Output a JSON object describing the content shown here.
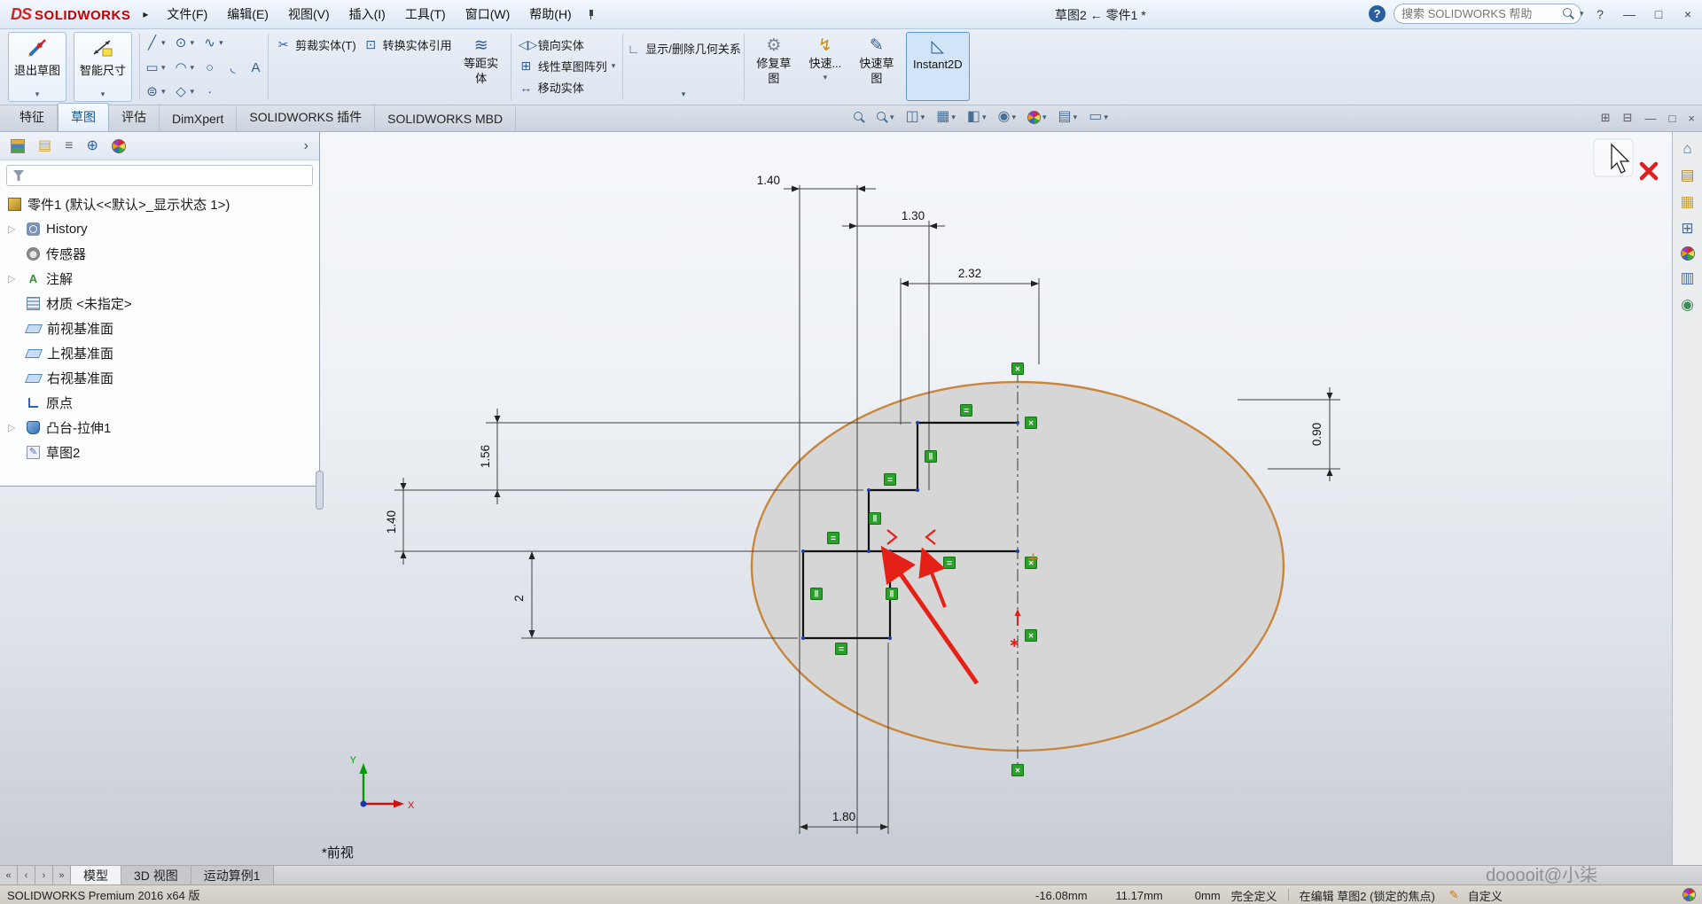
{
  "titlebar": {
    "logo_ds": "DS",
    "logo_text": "SOLIDWORKS",
    "menu_expand": "▸",
    "menus": [
      "文件(F)",
      "编辑(E)",
      "视图(V)",
      "插入(I)",
      "工具(T)",
      "窗口(W)",
      "帮助(H)"
    ],
    "doc_title": "草图2 ← 零件1 *",
    "help_badge": "?",
    "search_placeholder": "搜索 SOLIDWORKS 帮助",
    "help_menu": "?",
    "win_min": "—",
    "win_max": "□",
    "win_close": "×"
  },
  "ribbon": {
    "exit_sketch": "退出草图",
    "smart_dimension": "智能尺寸",
    "trim_entities": "剪裁实体(T)",
    "convert_entities": "转换实体引用",
    "offset_l1": "等距实",
    "offset_l2": "体",
    "mirror_entities": "镜向实体",
    "linear_pattern": "线性草图阵列",
    "move_entities": "移动实体",
    "display_relations": "显示/删除几何关系",
    "repair_l1": "修复草",
    "repair_l2": "图",
    "quick_snaps": "快速...",
    "rapid_l1": "快速草",
    "rapid_l2": "图",
    "instant2d": "Instant2D"
  },
  "tabs": {
    "items": [
      "特征",
      "草图",
      "评估",
      "DimXpert",
      "SOLIDWORKS 插件",
      "SOLIDWORKS MBD"
    ],
    "active": "草图"
  },
  "feature_tree": {
    "root": "零件1 (默认<<默认>_显示状态 1>)",
    "items": [
      "History",
      "传感器",
      "注解",
      "材质 <未指定>",
      "前视基准面",
      "上视基准面",
      "右视基准面",
      "原点",
      "凸台-拉伸1",
      "草图2"
    ]
  },
  "viewport": {
    "view_label": "*前视",
    "axis_x": "X",
    "axis_y": "Y",
    "dims": {
      "top140": "1.40",
      "d130": "1.30",
      "d232": "2.32",
      "d156": "1.56",
      "left140": "1.40",
      "d2": "2",
      "d180": "1.80",
      "d090": "0.90"
    }
  },
  "bottom_tabs": {
    "nav": [
      "«",
      "‹",
      "›",
      "»"
    ],
    "items": [
      "模型",
      "3D 视图",
      "运动算例1"
    ],
    "active": "模型"
  },
  "status": {
    "version": "SOLIDWORKS Premium 2016 x64 版",
    "x": "-16.08mm",
    "y": "11.17mm",
    "z": "0mm",
    "state": "完全定义",
    "editing": "在编辑 草图2 (锁定的焦点)",
    "custom": "自定义"
  },
  "watermark": "dooooit@小柒",
  "glyphs": {
    "caret": "▾",
    "rel_h": "=",
    "rel_v": "‖",
    "rel_c": "×",
    "line": "╱",
    "circle": "⊙",
    "spline": "∿",
    "rect": "▭",
    "arc": "◠",
    "ellipse": "○",
    "fillet": "◟",
    "text_tool": "A",
    "slot": "⊜",
    "polygon": "◇",
    "point": "·",
    "trim": "✂",
    "convert": "⊡",
    "offset": "≋",
    "mirror": "◁▷",
    "pattern": "⊞",
    "move": "↔",
    "relations": "∟",
    "repair": "⚙",
    "quick": "↯",
    "rapid": "✎",
    "instant": "◺",
    "hud_section": "◫",
    "hud_orient": "▦",
    "hud_style": "◧",
    "hud_eye": "◉",
    "hud_scene": "▤",
    "hud_monitor": "▭",
    "doc_pane": "⊞",
    "doc_cascade": "⊟",
    "doc_min": "—",
    "doc_restore": "□",
    "doc_close": "×",
    "fm_property": "▤",
    "fm_config": "≡",
    "fm_dimxpert": "⊕",
    "fm_collapse": "›",
    "tp_home": "⌂",
    "tp_library": "▤",
    "tp_explorer": "▦",
    "tp_palette": "⊞",
    "tp_props": "▥",
    "tp_forum": "◉",
    "status_pencil": "✎"
  }
}
